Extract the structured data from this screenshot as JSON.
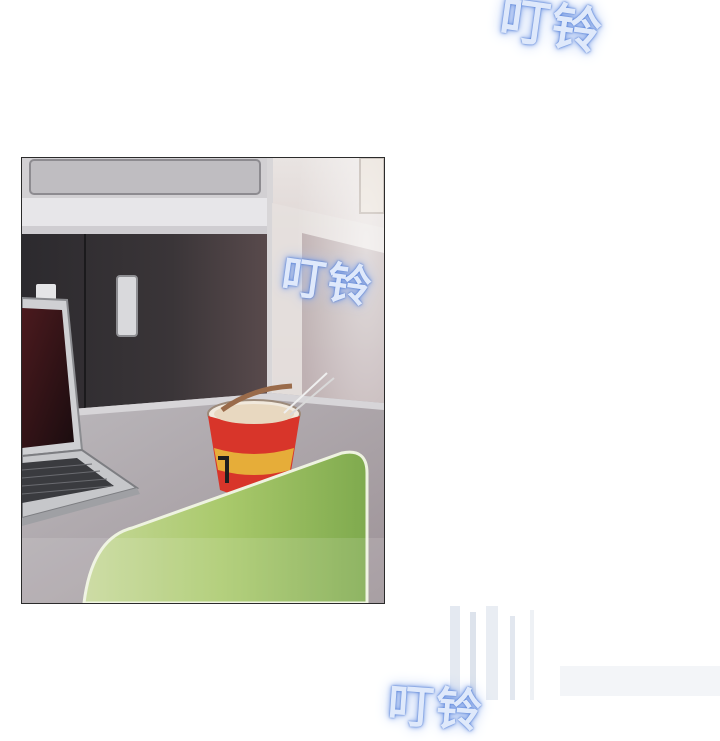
{
  "sound_effects": {
    "top": "叮铃",
    "middle": "叮铃",
    "bottom": "叮铃"
  },
  "colors": {
    "background": "#ffffff",
    "sfx_fill": "#dfe9fb",
    "sfx_glow": "#5b83db",
    "chair": "#9fc766",
    "noodle_cup": "#d8352a",
    "counter": "#b9b7bb"
  },
  "icons": [
    "laptop-icon",
    "noodle-cup-icon",
    "chopsticks-icon",
    "chair-icon"
  ]
}
